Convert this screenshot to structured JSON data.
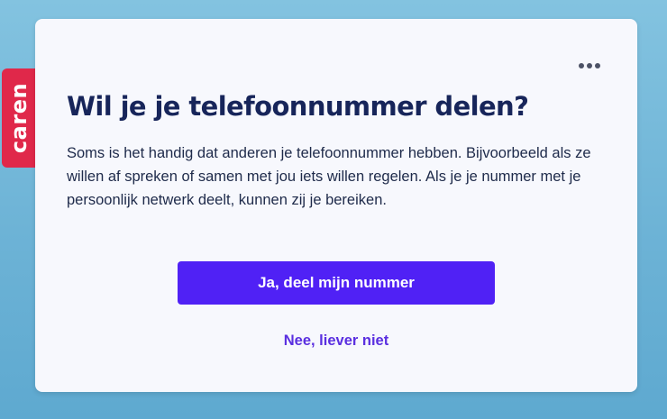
{
  "brand": {
    "logo_text": "caren",
    "color": "#e0284a"
  },
  "dialog": {
    "menu_icon": "more-horizontal-icon",
    "title": "Wil je je telefoonnummer delen?",
    "body": "Soms is het handig dat anderen je telefoonnummer hebben. Bijvoorbeeld als ze willen af spreken of samen met jou iets willen regelen. Als je je nummer met je persoonlijk netwerk deelt, kunnen zij je bereiken.",
    "primary_button_label": "Ja, deel mijn nummer",
    "secondary_button_label": "Nee, liever niet"
  },
  "colors": {
    "primary": "#5021f5",
    "title": "#17255a",
    "background": "#6db3d6",
    "card": "#f7f8fd"
  }
}
